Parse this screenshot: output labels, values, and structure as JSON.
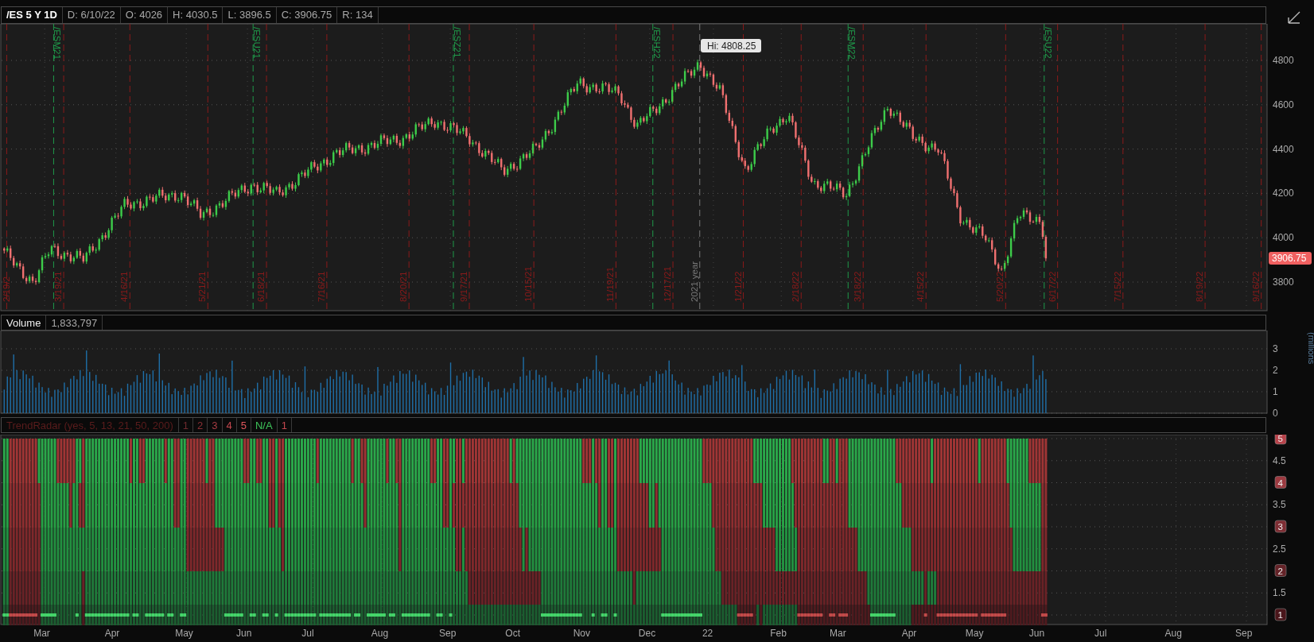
{
  "header": {
    "symbol": "/ES 5 Y 1D",
    "fields": [
      "D: 6/10/22",
      "O: 4026",
      "H: 4030.5",
      "L: 3896.5",
      "C: 3906.75",
      "R: 134"
    ]
  },
  "price_chart": {
    "expirations": [
      "/ESM21",
      "/ESU21",
      "/ESZ21",
      "/ESH22",
      "/ESM22",
      "/ESU22"
    ],
    "date_markers": [
      "2/19/2",
      "3/19/21",
      "4/16/21",
      "5/21/21",
      "6/18/21",
      "7/16/21",
      "8/20/21",
      "9/17/21",
      "10/15/21",
      "11/19/21",
      "12/17/21",
      "1/21/22",
      "2/18/22",
      "3/18/22",
      "4/15/22",
      "5/20/22",
      "6/17/22",
      "7/15/22",
      "8/19/22",
      "9/16/22"
    ],
    "year_marker": "2021 year",
    "high_label": "Hi: 4808.25",
    "price_axis": [
      "4800",
      "4600",
      "4400",
      "4200",
      "4000",
      "3800"
    ],
    "last_price": "3906.75"
  },
  "volume": {
    "title": "Volume",
    "value": "1,833,797",
    "axis": [
      "3",
      "2",
      "1",
      "0"
    ],
    "unit": "(millions"
  },
  "trendradar": {
    "title": "TrendRadar (yes, 5, 13, 21, 50, 200)",
    "buttons": [
      {
        "label": "1",
        "color": "#6e2a2e"
      },
      {
        "label": "2",
        "color": "#8a3035"
      },
      {
        "label": "3",
        "color": "#a63c42"
      },
      {
        "label": "4",
        "color": "#c4474e"
      },
      {
        "label": "5",
        "color": "#e0565c"
      },
      {
        "label": "N/A",
        "color": "#3ec45a"
      },
      {
        "label": "1",
        "color": "#c4474e"
      }
    ],
    "axis": [
      {
        "label": "5",
        "kind": "badge",
        "color": "#b8434b"
      },
      {
        "label": "4.5",
        "kind": "plain"
      },
      {
        "label": "4",
        "kind": "badge",
        "color": "#9c3a40"
      },
      {
        "label": "3.5",
        "kind": "plain"
      },
      {
        "label": "3",
        "kind": "badge",
        "color": "#7e2e34"
      },
      {
        "label": "2.5",
        "kind": "plain"
      },
      {
        "label": "2",
        "kind": "badge",
        "color": "#642328"
      },
      {
        "label": "1.5",
        "kind": "plain"
      },
      {
        "label": "1",
        "kind": "badge",
        "color": "#4a161b"
      }
    ]
  },
  "time_axis": [
    "Mar",
    "Apr",
    "May",
    "Jun",
    "Jul",
    "Aug",
    "Sep",
    "Oct",
    "Nov",
    "Dec",
    "22",
    "Feb",
    "Mar",
    "Apr",
    "May",
    "Jun",
    "Jul",
    "Aug",
    "Sep"
  ]
}
